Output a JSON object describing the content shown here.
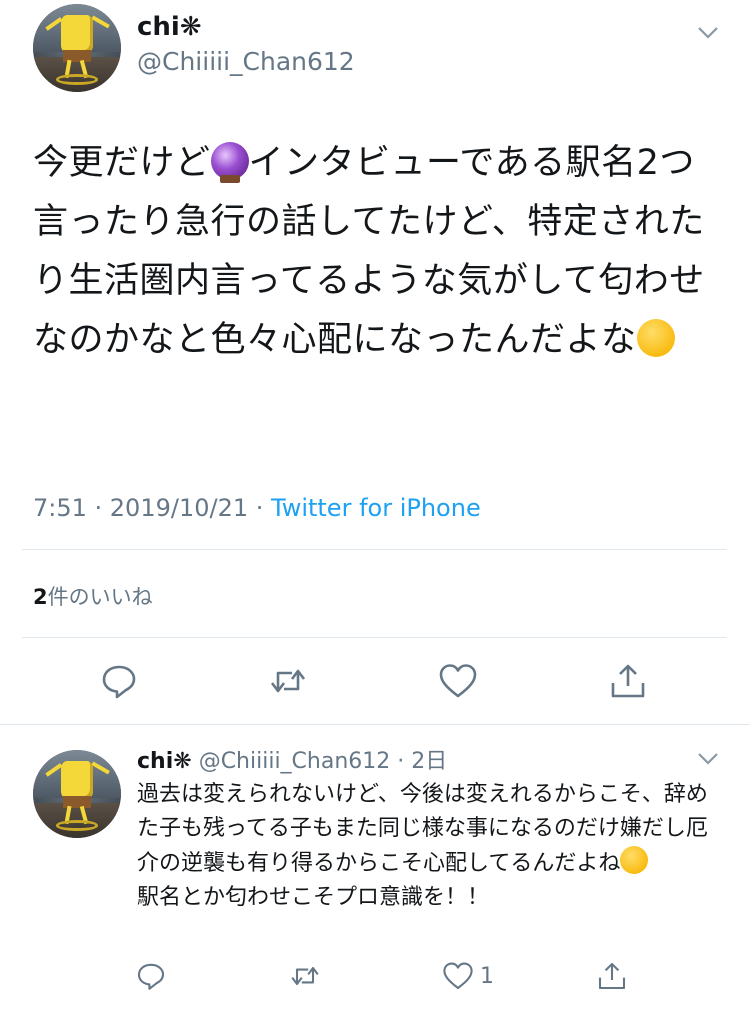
{
  "tweet": {
    "author_name": "chi❋",
    "author_handle": "@Chiiiii_Chan612",
    "text_part1": "今更だけど",
    "text_part2": "インタビューである駅名2つ言ったり急行の話してたけど、特定されたり生活圏内言ってるような気がして匂わせなのかなと色々心配になったんだよな",
    "emoji_1": "crystal-ball-emoji",
    "emoji_2": "thinking-face-emoji",
    "timestamp": "7:51 · 2019/10/21 · ",
    "source": "Twitter for iPhone",
    "likes_count": "2",
    "likes_label": "件のいいね"
  },
  "actions": {
    "reply_icon": "reply-icon",
    "retweet_icon": "retweet-icon",
    "like_icon": "heart-icon",
    "share_icon": "share-icon"
  },
  "reply": {
    "author_name": "chi❋",
    "author_handle": "@Chiiiii_Chan612",
    "time": "· 2日",
    "text_part1": "過去は変えられないけど、今後は変えれるからこそ、辞めた子も残ってる子もまた同じ様な事になるのだけ嫌だし厄介の逆襲も有り得るからこそ心配してるんだよね",
    "text_part2": "駅名とか匂わせこそプロ意識を！！",
    "emoji": "loudly-crying-face-emoji",
    "like_count": "1"
  },
  "colors": {
    "accent": "#1da1f2",
    "text": "#14171a",
    "secondary": "#657786",
    "divider": "#e1e8ed"
  }
}
